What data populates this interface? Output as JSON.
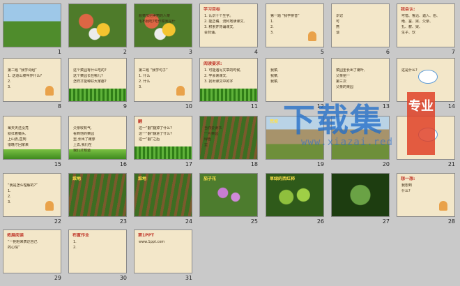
{
  "slides": [
    {
      "n": "1",
      "title": "",
      "lines": []
    },
    {
      "n": "2",
      "title": "",
      "lines": []
    },
    {
      "n": "3",
      "title": "",
      "lines": [
        "颜菜加把美丽的人菜",
        "毛布我吃?吃作菜我是什"
      ]
    },
    {
      "n": "4",
      "title": "学习目标",
      "lines": [
        "1. 认识十个生字。",
        "2. 能正确、流利地读课文,",
        "3. 积累并背诵课文,",
        "   会背诵。"
      ]
    },
    {
      "n": "5",
      "title": "",
      "lines": [
        "第一题 “我学拼音”",
        "1.",
        "2.",
        "3."
      ]
    },
    {
      "n": "6",
      "title": "",
      "lines": [
        "识记",
        "可",
        "燕",
        "谈"
      ]
    },
    {
      "n": "7",
      "title": "我会认:",
      "lines": [
        "可惜、鲁迅、遇入、伯、",
        "绝、蚕、梁、父亲、",
        "扎、薪、梁、",
        "生子、饮"
      ]
    },
    {
      "n": "8",
      "title": "",
      "lines": [
        "第二题 “我学词组”",
        "1. 这道山坡叫作什么?",
        "2.",
        "3."
      ]
    },
    {
      "n": "9",
      "title": "",
      "lines": [
        "这个菜园有什么吃的?",
        "这个菜园长在哪儿?",
        "怎样才能种好大家都?"
      ]
    },
    {
      "n": "10",
      "title": "",
      "lines": [
        "第三题 “我学句子”",
        "1. 什么",
        "2. 什么",
        "3."
      ]
    },
    {
      "n": "11",
      "title": "阅读要求:",
      "lines": [
        "1. 可能遇写文章的时候,",
        "2. 学会读课文,",
        "3. 找出课文中的字"
      ]
    },
    {
      "n": "12",
      "title": "",
      "lines": [
        "我菜,",
        "我菜,",
        "我菜,"
      ]
    },
    {
      "n": "13",
      "title": "",
      "lines": [
        "菜园里长出了嫩叶,",
        "父亲把一",
        "第三次",
        "父亲的果园"
      ]
    },
    {
      "n": "14",
      "title": "",
      "lines": [
        "这是什么?"
      ]
    },
    {
      "n": "15",
      "title": "",
      "lines": [
        "每天天还没亮",
        "就扛着锄头,",
        "上山去,直到",
        "很晚才回家来"
      ]
    },
    {
      "n": "16",
      "title": "",
      "lines": [
        "父亲收有气,",
        "看到他的菜园",
        "里,长出了嫩芽",
        "上去,我们在",
        "我们才知道"
      ]
    },
    {
      "n": "17",
      "title": "翻",
      "lines": [
        "这一“翻”翻掉了什么?",
        "这一“翻”翻进了什么?",
        "这一“翻”之后"
      ]
    },
    {
      "n": "18",
      "title": "",
      "lines": [
        "当你爱读书",
        "一片菜园",
        "绿色",
        "里"
      ]
    },
    {
      "n": "19",
      "title": "荒坡",
      "lines": []
    },
    {
      "n": "20",
      "title": "",
      "lines": []
    },
    {
      "n": "21",
      "title": "",
      "lines": []
    },
    {
      "n": "22",
      "title": "",
      "lines": [
        "“我是怎么理解的?”",
        "1.",
        "2.",
        "3."
      ]
    },
    {
      "n": "23",
      "title": "菜地",
      "lines": []
    },
    {
      "n": "24",
      "title": "菜地",
      "lines": []
    },
    {
      "n": "25",
      "title": "茄子花",
      "lines": []
    },
    {
      "n": "26",
      "title": "草绿的西红柿",
      "lines": []
    },
    {
      "n": "27",
      "title": "",
      "lines": []
    },
    {
      "n": "28",
      "title": "想一想:",
      "lines": [
        "我想到",
        "什么?"
      ]
    },
    {
      "n": "29",
      "title": "拓展阅读",
      "lines": [
        "“一把把来表达自己",
        "的心情”"
      ]
    },
    {
      "n": "30",
      "title": "布置作业",
      "lines": [
        "1.",
        "2."
      ]
    },
    {
      "n": "31",
      "title": "第1PPT",
      "lines": [
        "www.1ppt.com"
      ]
    }
  ],
  "watermark": {
    "main": "下载集",
    "badge": "专业",
    "url": "www.xiazai.red"
  }
}
